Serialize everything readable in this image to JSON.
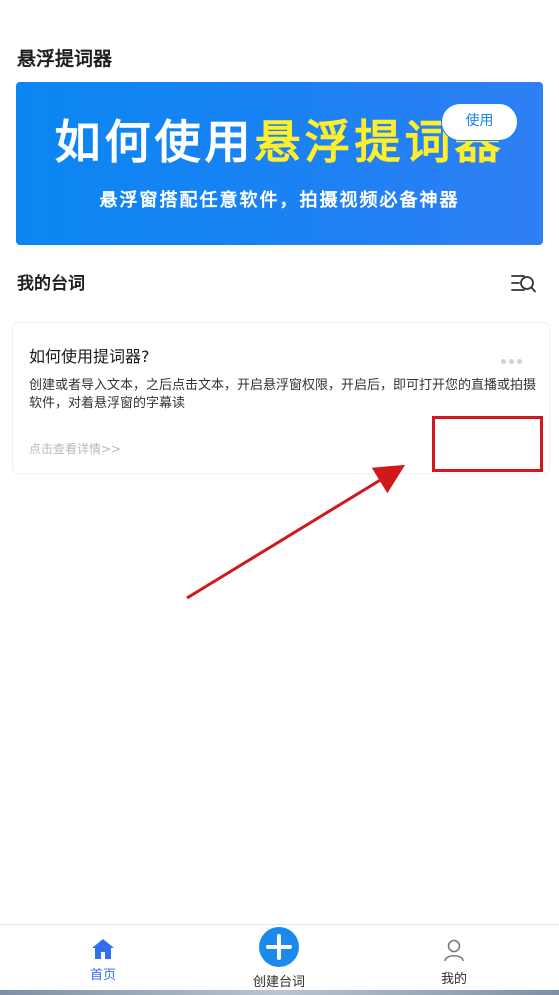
{
  "app": {
    "title": "悬浮提词器"
  },
  "banner": {
    "headline_white": "如何使用",
    "headline_yellow": "悬浮提词器",
    "subtitle": "悬浮窗搭配任意软件，拍摄视频必备神器",
    "colors": {
      "background": "#1a82f4",
      "highlight": "#ffee2a"
    }
  },
  "section": {
    "title": "我的台词",
    "filter_icon": "list-search-icon"
  },
  "script_card": {
    "title": "如何使用提词器?",
    "description": "创建或者导入文本，之后点击文本，开启悬浮窗权限，开启后，即可打开您的直播或拍摄软件，对着悬浮窗的字幕读",
    "detail_link": "点击查看详情>>",
    "use_button": "使用",
    "more_icon": "more-dots-icon"
  },
  "tabbar": {
    "home": {
      "label": "首页",
      "icon": "home-icon",
      "active": true
    },
    "create": {
      "label": "创建台词",
      "icon": "plus-icon"
    },
    "mine": {
      "label": "我的",
      "icon": "user-icon"
    },
    "active_color": "#2f6ff0"
  },
  "annotation_color": "#d0191c"
}
